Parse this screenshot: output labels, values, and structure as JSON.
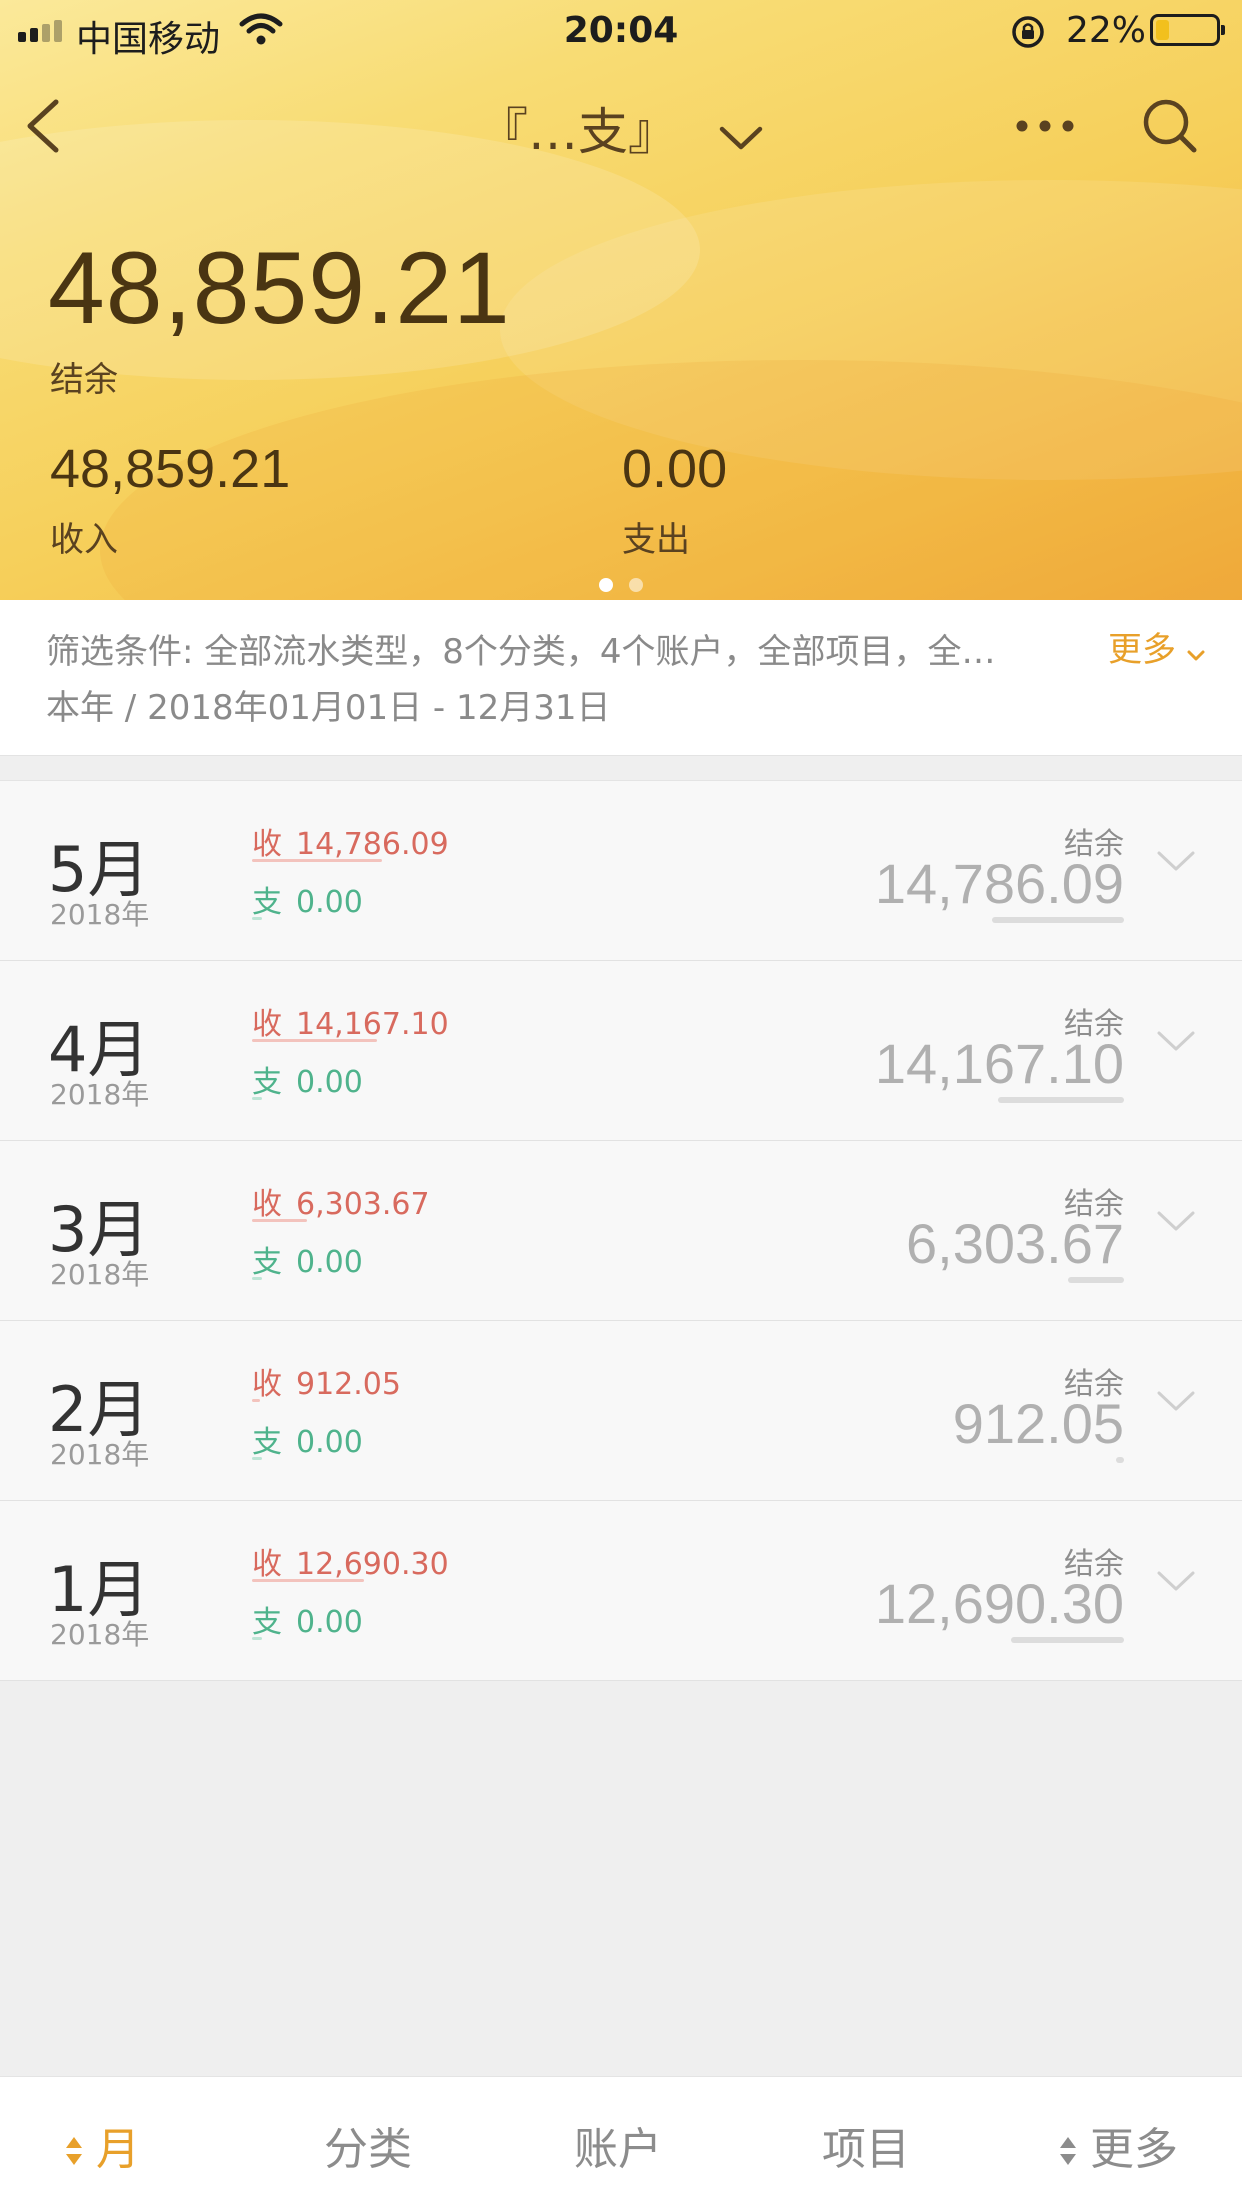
{
  "status_bar": {
    "carrier": "中国移动",
    "time": "20:04",
    "battery": "22%",
    "battery_level": 0.22
  },
  "nav": {
    "title": "『…支』",
    "icons": [
      "back-icon",
      "chevron-down-icon",
      "more-icon",
      "search-icon"
    ]
  },
  "summary": {
    "balance": "48,859.21",
    "balance_label": "结余",
    "income": "48,859.21",
    "income_label": "收入",
    "expense": "0.00",
    "expense_label": "支出"
  },
  "pager": {
    "count": 2,
    "active": 0
  },
  "filter": {
    "conditions": "筛选条件: 全部流水类型，8个分类，4个账户，全部项目，全…",
    "date_range": "本年 / 2018年01月01日 - 12月31日",
    "more_label": "更多"
  },
  "months": [
    {
      "month": "5月",
      "year": "2018年",
      "income_label": "收",
      "income": "14,786.09",
      "expense_label": "支",
      "expense": "0.00",
      "balance_label": "结余",
      "balance": "14,786.09",
      "share": 1.0
    },
    {
      "month": "4月",
      "year": "2018年",
      "income_label": "收",
      "income": "14,167.10",
      "expense_label": "支",
      "expense": "0.00",
      "balance_label": "结余",
      "balance": "14,167.10",
      "share": 0.958
    },
    {
      "month": "3月",
      "year": "2018年",
      "income_label": "收",
      "income": "6,303.67",
      "expense_label": "支",
      "expense": "0.00",
      "balance_label": "结余",
      "balance": "6,303.67",
      "share": 0.426
    },
    {
      "month": "2月",
      "year": "2018年",
      "income_label": "收",
      "income": "912.05",
      "expense_label": "支",
      "expense": "0.00",
      "balance_label": "结余",
      "balance": "912.05",
      "share": 0.062
    },
    {
      "month": "1月",
      "year": "2018年",
      "income_label": "收",
      "income": "12,690.30",
      "expense_label": "支",
      "expense": "0.00",
      "balance_label": "结余",
      "balance": "12,690.30",
      "share": 0.858
    }
  ],
  "tabs": [
    {
      "label": "月",
      "active": true,
      "sort_icon": true
    },
    {
      "label": "分类",
      "active": false,
      "sort_icon": false
    },
    {
      "label": "账户",
      "active": false,
      "sort_icon": false
    },
    {
      "label": "项目",
      "active": false,
      "sort_icon": false
    },
    {
      "label": "更多",
      "active": false,
      "sort_icon": true
    }
  ],
  "colors": {
    "accent": "#e8a02a",
    "income": "#d86a5e",
    "expense": "#4fb38c",
    "header_start": "#fbe99a",
    "header_end": "#f0ab3c"
  }
}
